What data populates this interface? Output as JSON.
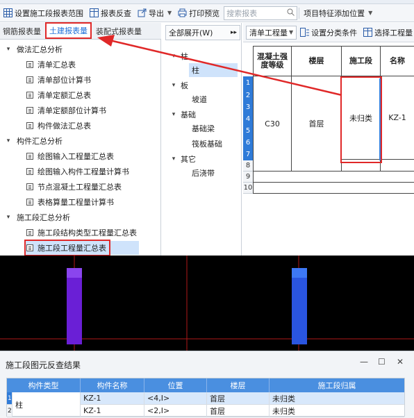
{
  "toolbar": {
    "set_range": "设置施工段报表范围",
    "reverse": "报表反查",
    "export": "导出",
    "print": "打印预览",
    "search_placeholder": "搜索报表",
    "add_feature": "项目特征添加位置"
  },
  "tabs": [
    "钢筋报表量",
    "土建报表量",
    "装配式报表量"
  ],
  "tree": {
    "g1": "做法汇总分析",
    "g1_items": [
      "清单汇总表",
      "清单部位计算书",
      "清单定额汇总表",
      "清单定额部位计算书",
      "构件做法汇总表"
    ],
    "g2": "构件汇总分析",
    "g2_items": [
      "绘图输入工程量汇总表",
      "绘图输入构件工程量计算书",
      "节点混凝土工程量汇总表",
      "表格算量工程量计算书"
    ],
    "g3": "施工段汇总分析",
    "g3_items": [
      "施工段结构类型工程量汇总表",
      "施工段工程量汇总表"
    ]
  },
  "mid": {
    "expand_all": "全部展开(W)",
    "groups": [
      {
        "name": "柱",
        "items": [
          "柱"
        ]
      },
      {
        "name": "板",
        "items": [
          "坡道"
        ]
      },
      {
        "name": "基础",
        "items": [
          "基础梁",
          "筏板基础"
        ]
      },
      {
        "name": "其它",
        "items": [
          "后浇带"
        ]
      }
    ]
  },
  "right_toolbar": {
    "select": "清单工程量",
    "set_category": "设置分类条件",
    "choose": "选择工程量"
  },
  "grid": {
    "headers": [
      "混凝土强度等级",
      "楼层",
      "施工段",
      "名称"
    ],
    "concrete": "C30",
    "floor": "首层",
    "segment": "未归类",
    "name": "KZ-1",
    "row_numbers": [
      "1",
      "2",
      "3",
      "4",
      "5",
      "6",
      "7",
      "8",
      "9",
      "10"
    ]
  },
  "result": {
    "title": "施工段图元反查结果",
    "controls": {
      "minimize": "—",
      "restore": "☐",
      "close": "✕"
    },
    "columns": [
      "构件类型",
      "构件名称",
      "位置",
      "楼层",
      "施工段归属"
    ],
    "type_value": "柱",
    "rows": [
      {
        "num": "1",
        "name": "KZ-1",
        "pos": "<4,I>",
        "floor": "首层",
        "segment": "未归类"
      },
      {
        "num": "2",
        "name": "KZ-1",
        "pos": "<2,I>",
        "floor": "首层",
        "segment": "未归类"
      }
    ]
  },
  "colors": {
    "accent": "#1e6fd9",
    "highlight": "#e02828",
    "column_purple": "#6a1fd6",
    "column_blue": "#2a55e0"
  }
}
